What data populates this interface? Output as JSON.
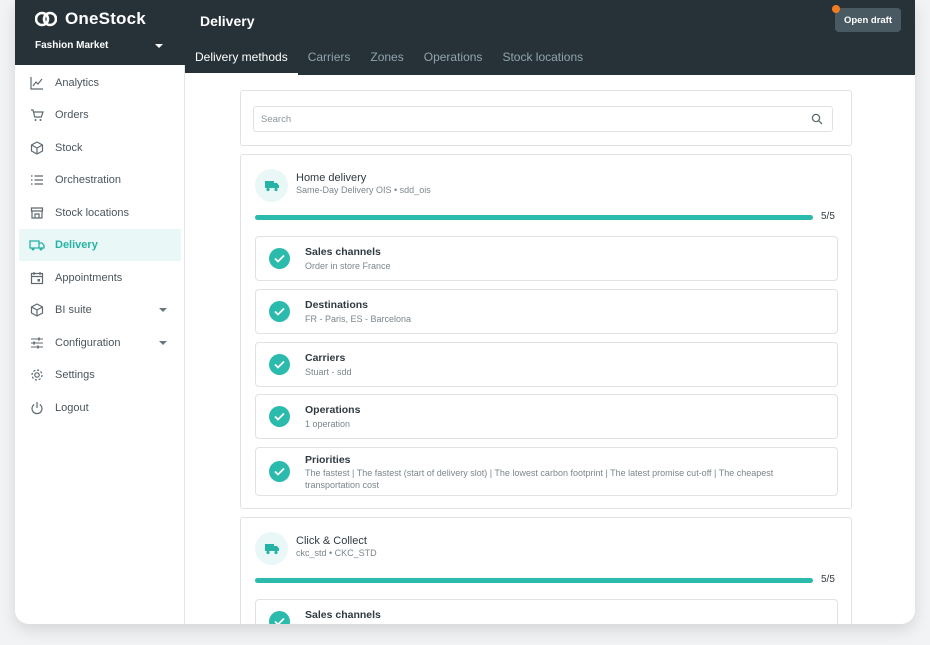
{
  "app": {
    "brand": "OneStock",
    "market": "Fashion Market",
    "page_title": "Delivery",
    "open_draft_label": "Open draft"
  },
  "tabs": [
    {
      "label": "Delivery methods",
      "active": true
    },
    {
      "label": "Carriers"
    },
    {
      "label": "Zones"
    },
    {
      "label": "Operations"
    },
    {
      "label": "Stock locations"
    }
  ],
  "sidebar": {
    "items": [
      {
        "label": "Analytics",
        "icon": "analytics-icon"
      },
      {
        "label": "Orders",
        "icon": "cart-icon"
      },
      {
        "label": "Stock",
        "icon": "box-icon"
      },
      {
        "label": "Orchestration",
        "icon": "list-icon"
      },
      {
        "label": "Stock locations",
        "icon": "store-icon"
      },
      {
        "label": "Delivery",
        "icon": "truck-icon",
        "active": true
      },
      {
        "label": "Appointments",
        "icon": "calendar-icon"
      },
      {
        "label": "BI suite",
        "icon": "cube-icon",
        "expandable": true
      },
      {
        "label": "Configuration",
        "icon": "sliders-icon",
        "expandable": true
      },
      {
        "label": "Settings",
        "icon": "gear-icon"
      },
      {
        "label": "Logout",
        "icon": "power-icon"
      }
    ]
  },
  "search": {
    "placeholder": "Search"
  },
  "delivery_methods": [
    {
      "title": "Home delivery",
      "subtitle": "Same-Day Delivery OIS • sdd_ois",
      "progress": 1.0,
      "progress_text": "5/5",
      "steps": [
        {
          "title": "Sales channels",
          "detail": "Order in store France"
        },
        {
          "title": "Destinations",
          "detail": "FR - Paris, ES - Barcelona"
        },
        {
          "title": "Carriers",
          "detail": "Stuart - sdd"
        },
        {
          "title": "Operations",
          "detail": "1 operation"
        },
        {
          "title": "Priorities",
          "detail": "The fastest | The fastest (start of delivery slot) | The lowest carbon footprint | The latest promise cut-off | The cheapest transportation cost"
        }
      ]
    },
    {
      "title": "Click & Collect",
      "subtitle": "ckc_std • CKC_STD",
      "progress": 1.0,
      "progress_text": "5/5",
      "steps": [
        {
          "title": "Sales channels",
          "detail": ""
        }
      ]
    }
  ],
  "colors": {
    "topbar": "#263238",
    "accent": "#2bbbad",
    "draft_dot": "#f47c20"
  }
}
